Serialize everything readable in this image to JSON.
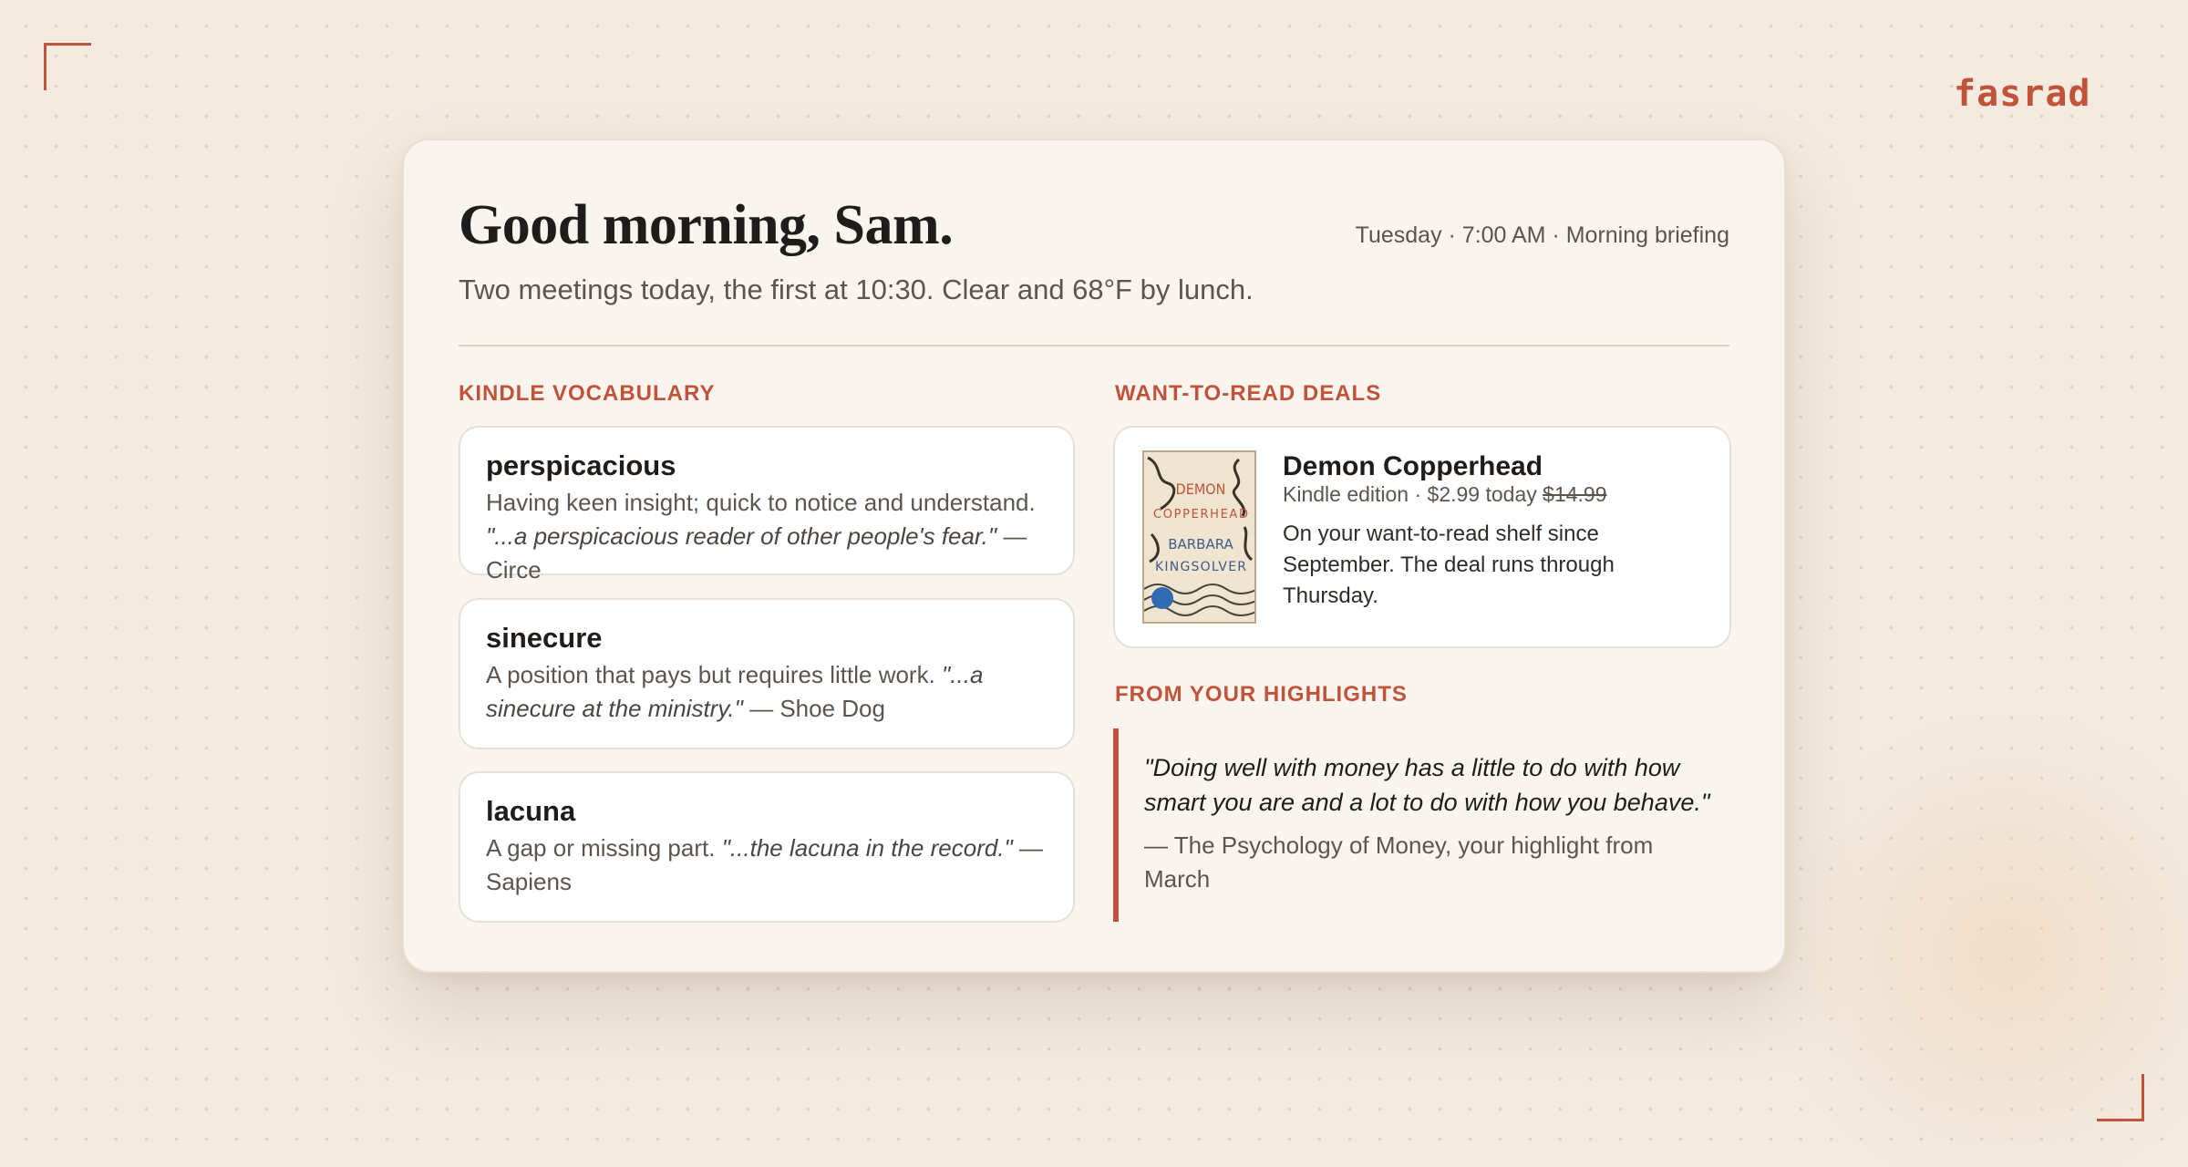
{
  "brand": {
    "logo": "fasrad",
    "accent": "#c0533a"
  },
  "header": {
    "greeting": "Good morning, Sam.",
    "dateline": "Tuesday · 7:00 AM · Morning briefing",
    "summary": "Two meetings today, the first at 10:30. Clear and 68°F by lunch."
  },
  "vocabulary": {
    "title": "KINDLE VOCABULARY",
    "items": [
      {
        "word": "perspicacious",
        "definition": "Having keen insight; quick to notice and understand.",
        "quote": "\"...a perspicacious reader of other people's fear.\"",
        "source": "— Circe"
      },
      {
        "word": "sinecure",
        "definition": "A position that pays but requires little work.",
        "quote": "\"...a sinecure at the ministry.\"",
        "source": "— Shoe Dog"
      },
      {
        "word": "lacuna",
        "definition": "A gap or missing part.",
        "quote": "\"...the lacuna in the record.\"",
        "source": "— Sapiens"
      }
    ]
  },
  "deals": {
    "title": "WANT-TO-READ DEALS",
    "book": {
      "title": "Demon Copperhead",
      "edition": "Kindle edition · $2.99 today",
      "old_price": "$14.99",
      "note": "On your want-to-read shelf since September. The deal runs through Thursday.",
      "cover_title": "DEMON COPPERHEAD",
      "cover_author": "BARBARA KINGSOLVER"
    }
  },
  "highlights": {
    "title": "FROM YOUR HIGHLIGHTS",
    "quote": "\"Doing well with money has a little to do with how smart you are and a lot to do with how you behave.\"",
    "source": "— The Psychology of Money, your highlight from March"
  }
}
